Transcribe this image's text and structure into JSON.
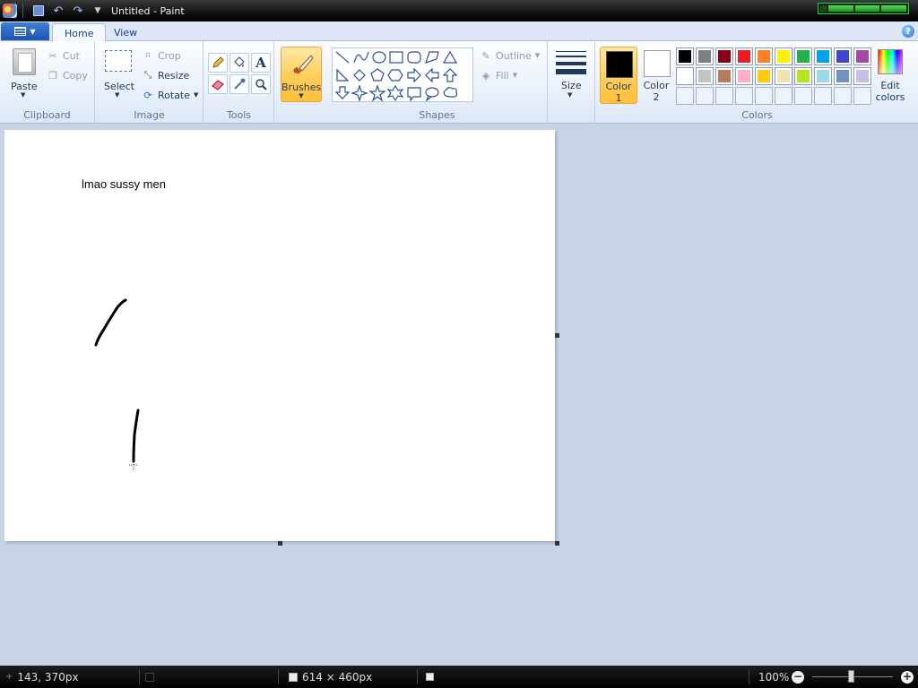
{
  "window": {
    "title": "Untitled - Paint"
  },
  "tabs": [
    {
      "label": "Home"
    },
    {
      "label": "View"
    }
  ],
  "clipboard": {
    "paste": "Paste",
    "cut": "Cut",
    "copy": "Copy",
    "group": "Clipboard"
  },
  "image": {
    "select": "Select",
    "crop": "Crop",
    "resize": "Resize",
    "rotate": "Rotate",
    "group": "Image"
  },
  "tools": {
    "group": "Tools",
    "items": [
      "pencil-icon",
      "fill-bucket-icon",
      "text-icon",
      "eraser-icon",
      "color-picker-icon",
      "magnifier-icon"
    ],
    "text_glyph": "A"
  },
  "brushes": {
    "label": "Brushes",
    "selected": true
  },
  "shapes": {
    "group": "Shapes",
    "outline": "Outline",
    "fill": "Fill"
  },
  "size": {
    "label": "Size"
  },
  "colors": {
    "group": "Colors",
    "color1_label_line1": "Color",
    "color1_label_line2": "1",
    "color2_label_line1": "Color",
    "color2_label_line2": "2",
    "color1": "#000000",
    "color2": "#ffffff",
    "edit_line1": "Edit",
    "edit_line2": "colors",
    "palette_row1": [
      "#000000",
      "#7f7f7f",
      "#880015",
      "#ed1c24",
      "#ff7f27",
      "#fff200",
      "#22b14c",
      "#00a2e8",
      "#3f48cc",
      "#a349a4"
    ],
    "palette_row2": [
      "#ffffff",
      "#c3c3c3",
      "#b97a57",
      "#ffaec9",
      "#ffc90e",
      "#efe4b0",
      "#b5e61d",
      "#99d9ea",
      "#7092be",
      "#c8bfe7"
    ]
  },
  "canvas": {
    "text": "lmao sussy men"
  },
  "status": {
    "cursor": "143, 370px",
    "size": "614 × 460px",
    "zoom": "100%",
    "minus": "−",
    "plus": "+"
  }
}
